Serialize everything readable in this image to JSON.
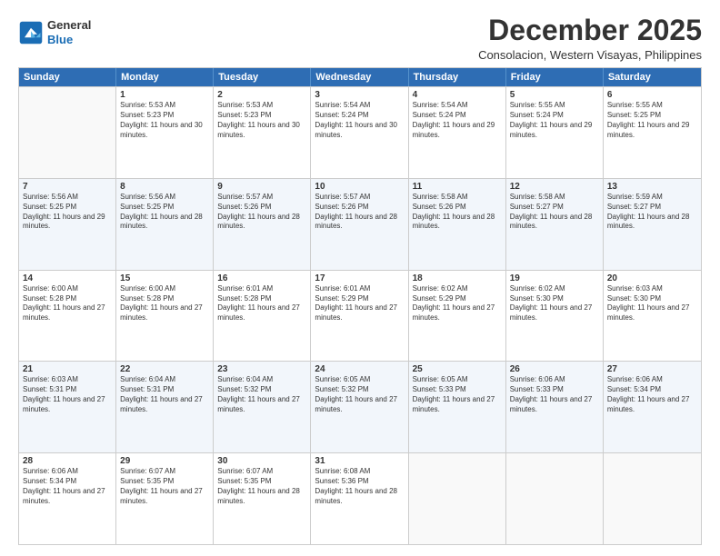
{
  "logo": {
    "general": "General",
    "blue": "Blue"
  },
  "title": "December 2025",
  "subtitle": "Consolacion, Western Visayas, Philippines",
  "headers": [
    "Sunday",
    "Monday",
    "Tuesday",
    "Wednesday",
    "Thursday",
    "Friday",
    "Saturday"
  ],
  "weeks": [
    [
      {
        "day": "",
        "sunrise": "",
        "sunset": "",
        "daylight": ""
      },
      {
        "day": "1",
        "sunrise": "Sunrise: 5:53 AM",
        "sunset": "Sunset: 5:23 PM",
        "daylight": "Daylight: 11 hours and 30 minutes."
      },
      {
        "day": "2",
        "sunrise": "Sunrise: 5:53 AM",
        "sunset": "Sunset: 5:23 PM",
        "daylight": "Daylight: 11 hours and 30 minutes."
      },
      {
        "day": "3",
        "sunrise": "Sunrise: 5:54 AM",
        "sunset": "Sunset: 5:24 PM",
        "daylight": "Daylight: 11 hours and 30 minutes."
      },
      {
        "day": "4",
        "sunrise": "Sunrise: 5:54 AM",
        "sunset": "Sunset: 5:24 PM",
        "daylight": "Daylight: 11 hours and 29 minutes."
      },
      {
        "day": "5",
        "sunrise": "Sunrise: 5:55 AM",
        "sunset": "Sunset: 5:24 PM",
        "daylight": "Daylight: 11 hours and 29 minutes."
      },
      {
        "day": "6",
        "sunrise": "Sunrise: 5:55 AM",
        "sunset": "Sunset: 5:25 PM",
        "daylight": "Daylight: 11 hours and 29 minutes."
      }
    ],
    [
      {
        "day": "7",
        "sunrise": "Sunrise: 5:56 AM",
        "sunset": "Sunset: 5:25 PM",
        "daylight": "Daylight: 11 hours and 29 minutes."
      },
      {
        "day": "8",
        "sunrise": "Sunrise: 5:56 AM",
        "sunset": "Sunset: 5:25 PM",
        "daylight": "Daylight: 11 hours and 28 minutes."
      },
      {
        "day": "9",
        "sunrise": "Sunrise: 5:57 AM",
        "sunset": "Sunset: 5:26 PM",
        "daylight": "Daylight: 11 hours and 28 minutes."
      },
      {
        "day": "10",
        "sunrise": "Sunrise: 5:57 AM",
        "sunset": "Sunset: 5:26 PM",
        "daylight": "Daylight: 11 hours and 28 minutes."
      },
      {
        "day": "11",
        "sunrise": "Sunrise: 5:58 AM",
        "sunset": "Sunset: 5:26 PM",
        "daylight": "Daylight: 11 hours and 28 minutes."
      },
      {
        "day": "12",
        "sunrise": "Sunrise: 5:58 AM",
        "sunset": "Sunset: 5:27 PM",
        "daylight": "Daylight: 11 hours and 28 minutes."
      },
      {
        "day": "13",
        "sunrise": "Sunrise: 5:59 AM",
        "sunset": "Sunset: 5:27 PM",
        "daylight": "Daylight: 11 hours and 28 minutes."
      }
    ],
    [
      {
        "day": "14",
        "sunrise": "Sunrise: 6:00 AM",
        "sunset": "Sunset: 5:28 PM",
        "daylight": "Daylight: 11 hours and 27 minutes."
      },
      {
        "day": "15",
        "sunrise": "Sunrise: 6:00 AM",
        "sunset": "Sunset: 5:28 PM",
        "daylight": "Daylight: 11 hours and 27 minutes."
      },
      {
        "day": "16",
        "sunrise": "Sunrise: 6:01 AM",
        "sunset": "Sunset: 5:28 PM",
        "daylight": "Daylight: 11 hours and 27 minutes."
      },
      {
        "day": "17",
        "sunrise": "Sunrise: 6:01 AM",
        "sunset": "Sunset: 5:29 PM",
        "daylight": "Daylight: 11 hours and 27 minutes."
      },
      {
        "day": "18",
        "sunrise": "Sunrise: 6:02 AM",
        "sunset": "Sunset: 5:29 PM",
        "daylight": "Daylight: 11 hours and 27 minutes."
      },
      {
        "day": "19",
        "sunrise": "Sunrise: 6:02 AM",
        "sunset": "Sunset: 5:30 PM",
        "daylight": "Daylight: 11 hours and 27 minutes."
      },
      {
        "day": "20",
        "sunrise": "Sunrise: 6:03 AM",
        "sunset": "Sunset: 5:30 PM",
        "daylight": "Daylight: 11 hours and 27 minutes."
      }
    ],
    [
      {
        "day": "21",
        "sunrise": "Sunrise: 6:03 AM",
        "sunset": "Sunset: 5:31 PM",
        "daylight": "Daylight: 11 hours and 27 minutes."
      },
      {
        "day": "22",
        "sunrise": "Sunrise: 6:04 AM",
        "sunset": "Sunset: 5:31 PM",
        "daylight": "Daylight: 11 hours and 27 minutes."
      },
      {
        "day": "23",
        "sunrise": "Sunrise: 6:04 AM",
        "sunset": "Sunset: 5:32 PM",
        "daylight": "Daylight: 11 hours and 27 minutes."
      },
      {
        "day": "24",
        "sunrise": "Sunrise: 6:05 AM",
        "sunset": "Sunset: 5:32 PM",
        "daylight": "Daylight: 11 hours and 27 minutes."
      },
      {
        "day": "25",
        "sunrise": "Sunrise: 6:05 AM",
        "sunset": "Sunset: 5:33 PM",
        "daylight": "Daylight: 11 hours and 27 minutes."
      },
      {
        "day": "26",
        "sunrise": "Sunrise: 6:06 AM",
        "sunset": "Sunset: 5:33 PM",
        "daylight": "Daylight: 11 hours and 27 minutes."
      },
      {
        "day": "27",
        "sunrise": "Sunrise: 6:06 AM",
        "sunset": "Sunset: 5:34 PM",
        "daylight": "Daylight: 11 hours and 27 minutes."
      }
    ],
    [
      {
        "day": "28",
        "sunrise": "Sunrise: 6:06 AM",
        "sunset": "Sunset: 5:34 PM",
        "daylight": "Daylight: 11 hours and 27 minutes."
      },
      {
        "day": "29",
        "sunrise": "Sunrise: 6:07 AM",
        "sunset": "Sunset: 5:35 PM",
        "daylight": "Daylight: 11 hours and 27 minutes."
      },
      {
        "day": "30",
        "sunrise": "Sunrise: 6:07 AM",
        "sunset": "Sunset: 5:35 PM",
        "daylight": "Daylight: 11 hours and 28 minutes."
      },
      {
        "day": "31",
        "sunrise": "Sunrise: 6:08 AM",
        "sunset": "Sunset: 5:36 PM",
        "daylight": "Daylight: 11 hours and 28 minutes."
      },
      {
        "day": "",
        "sunrise": "",
        "sunset": "",
        "daylight": ""
      },
      {
        "day": "",
        "sunrise": "",
        "sunset": "",
        "daylight": ""
      },
      {
        "day": "",
        "sunrise": "",
        "sunset": "",
        "daylight": ""
      }
    ]
  ]
}
